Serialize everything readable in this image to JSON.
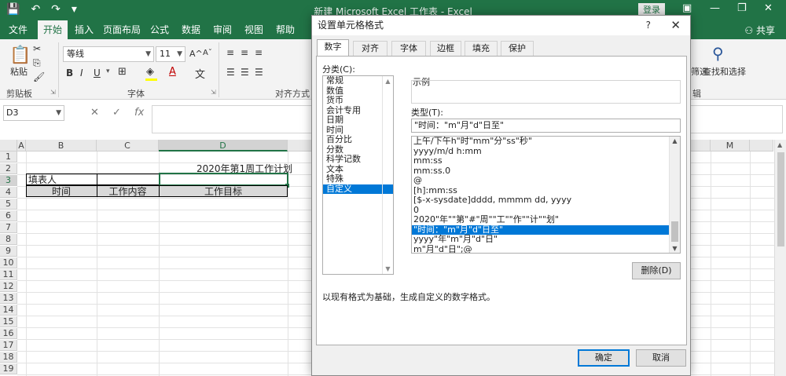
{
  "window": {
    "title": "新建 Microsoft Excel 工作表 - Excel",
    "login_label": "登录",
    "minimize_glyph": "—",
    "restore_glyph": "❐",
    "close_glyph": "✕",
    "ribbon_toggle_glyph": "▣"
  },
  "qat": {
    "save_glyph": "💾",
    "undo_glyph": "↶",
    "redo_glyph": "↷",
    "more_glyph": "▾"
  },
  "menu": {
    "tabs": [
      "文件",
      "开始",
      "插入",
      "页面布局",
      "公式",
      "数据",
      "审阅",
      "视图",
      "帮助"
    ],
    "active_tab": "开始",
    "share_label": "共享"
  },
  "ribbon": {
    "paste_label": "粘贴",
    "clipboard_group": "剪贴板",
    "font_group": "字体",
    "align_group": "对齐方式",
    "font_name": "等线",
    "font_size": "11",
    "bold": "B",
    "italic": "I",
    "underline": "U",
    "wen": "文",
    "font_color_label": "A",
    "grow_font": "A^",
    "shrink_font": "Aˇ",
    "find_label": "查找和选择",
    "filter_label": "筛选",
    "edit_group_tail": "辑"
  },
  "formula_bar": {
    "name_box": "D3",
    "cancel_glyph": "✕",
    "enter_glyph": "✓",
    "fx_glyph": "fx",
    "value": ""
  },
  "sheet": {
    "columns": [
      "A",
      "B",
      "C",
      "D",
      "M"
    ],
    "selected_column": "D",
    "rows": [
      "1",
      "2",
      "3",
      "4",
      "5",
      "6",
      "7",
      "8",
      "9",
      "10",
      "11",
      "12",
      "13",
      "14",
      "15",
      "16",
      "17",
      "18",
      "19"
    ],
    "selected_row": "3",
    "title_cell": "2020年第1周工作计划",
    "filler_label": "填表人",
    "header_time": "时间",
    "header_content": "工作内容",
    "header_goal": "工作目标"
  },
  "dialog": {
    "title": "设置单元格格式",
    "help_glyph": "?",
    "close_glyph": "✕",
    "tabs": [
      "数字",
      "对齐",
      "字体",
      "边框",
      "填充",
      "保护"
    ],
    "active_tab": "数字",
    "category_label": "分类(C):",
    "categories": [
      "常规",
      "数值",
      "货币",
      "会计专用",
      "日期",
      "时间",
      "百分比",
      "分数",
      "科学记数",
      "文本",
      "特殊",
      "自定义"
    ],
    "selected_category": "自定义",
    "sample_label": "示例",
    "type_label": "类型(T):",
    "type_value": "\"时间：\"m\"月\"d\"日至\"",
    "format_list": [
      "上午/下午h\"时\"mm\"分\"ss\"秒\"",
      "yyyy/m/d h:mm",
      "mm:ss",
      "mm:ss.0",
      "@",
      "[h]:mm:ss",
      "[$-x-sysdate]dddd, mmmm dd, yyyy",
      "0",
      "2020\"年\"\"第\"#\"周\"\"工\"\"作\"\"计\"\"划\"",
      "\"时间：\"m\"月\"d\"日至\"",
      "yyyy\"年\"m\"月\"d\"日\"",
      "m\"月\"d\"日\";@"
    ],
    "selected_format_index": 9,
    "delete_label": "删除(D)",
    "description": "以现有格式为基础，生成自定义的数字格式。",
    "ok_label": "确定",
    "cancel_label": "取消"
  },
  "colors": {
    "excel_green": "#217346",
    "selection_blue": "#0078d7",
    "dialog_bg": "#f0f0f0",
    "header_gray": "#d9d9d9"
  }
}
